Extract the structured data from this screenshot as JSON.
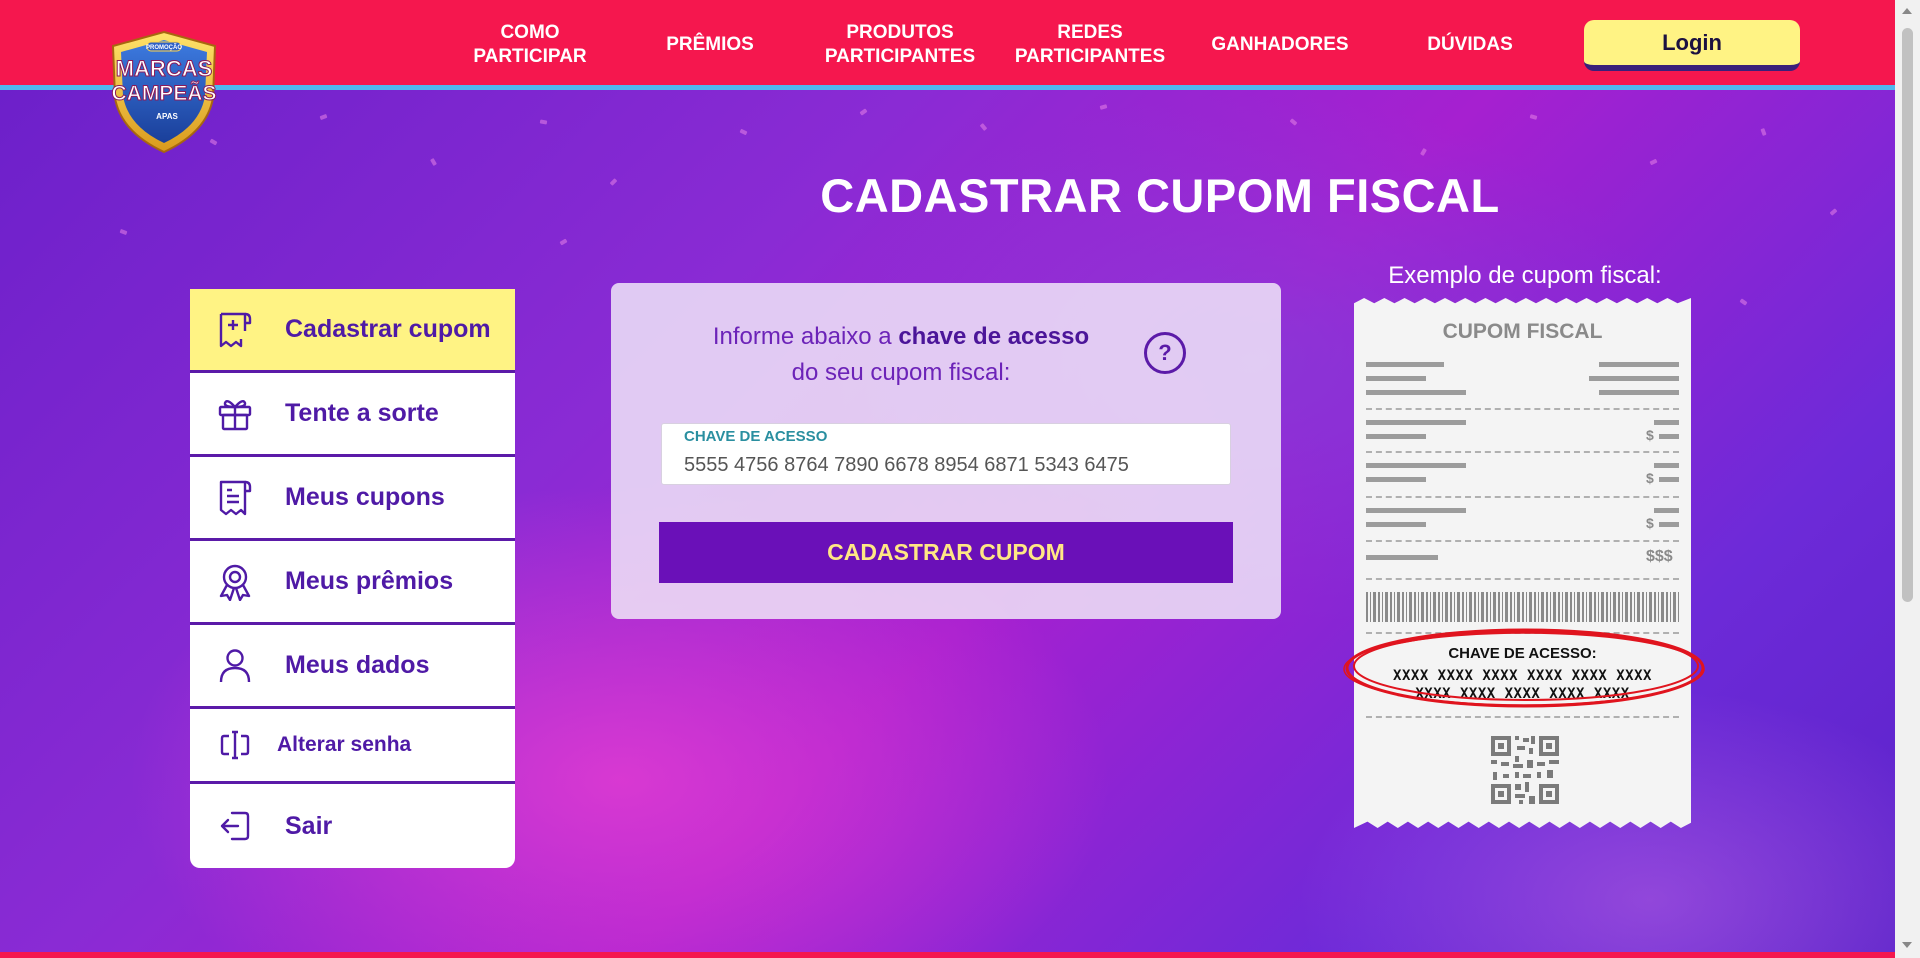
{
  "header": {
    "logo": {
      "line1": "MARCAS",
      "line2": "CAMPEÃS",
      "badge": "PROMOÇÃO",
      "brand": "APAS"
    },
    "nav": [
      {
        "label": "COMO\nPARTICIPAR"
      },
      {
        "label": "PRÊMIOS"
      },
      {
        "label": "PRODUTOS\nPARTICIPANTES"
      },
      {
        "label": "REDES\nPARTICIPANTES"
      },
      {
        "label": "GANHADORES"
      },
      {
        "label": "DÚVIDAS"
      }
    ],
    "login_label": "Login",
    "colors": {
      "bar": "#f5174e",
      "accent_line": "#4fb8ee",
      "login_bg": "#fff384"
    }
  },
  "page_title": "CADASTRAR CUPOM FISCAL",
  "sidebar": {
    "items": [
      {
        "label": "Cadastrar cupom",
        "icon": "receipt-plus-icon",
        "active": true
      },
      {
        "label": "Tente a sorte",
        "icon": "gift-icon"
      },
      {
        "label": "Meus cupons",
        "icon": "receipt-icon"
      },
      {
        "label": "Meus prêmios",
        "icon": "award-icon"
      },
      {
        "label": "Meus dados",
        "icon": "user-icon"
      },
      {
        "label": "Alterar senha",
        "icon": "password-icon"
      },
      {
        "label": "Sair",
        "icon": "logout-icon"
      }
    ]
  },
  "form": {
    "instruction_prefix": "Informe abaixo a ",
    "instruction_bold": "chave de acesso",
    "instruction_suffix": "do seu cupom fiscal:",
    "help_label": "?",
    "field_label": "CHAVE DE ACESSO",
    "field_value": "5555 4756 8764 7890 6678 8954 6871 5343 6475",
    "submit_label": "CADASTRAR CUPOM"
  },
  "example": {
    "title": "Exemplo de cupom fiscal:",
    "receipt_title": "CUPOM FISCAL",
    "currency": "$",
    "total": "$$$",
    "access_title": "CHAVE DE ACESSO:",
    "access_line1": "XXXX XXXX XXXX XXXX XXXX XXXX",
    "access_line2": "XXXX XXXX XXXX XXXX XXXX"
  }
}
